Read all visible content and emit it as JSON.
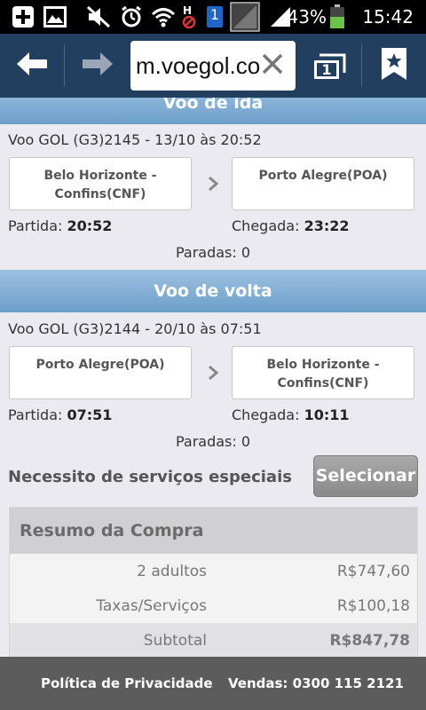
{
  "status_bar": {
    "battery_percent": "43%",
    "clock": "15:42",
    "notification_badge": "1",
    "icons": [
      "add-icon",
      "image-icon",
      "mute-icon",
      "alarm-icon",
      "wifi-icon",
      "no-sim-icon",
      "notification-count-icon",
      "signal-icon",
      "battery-icon"
    ]
  },
  "browser": {
    "url": "m.voegol.com",
    "tab_count": "1",
    "icons": [
      "back-arrow-icon",
      "forward-arrow-icon",
      "clear-icon",
      "tabs-icon",
      "bookmark-star-icon"
    ]
  },
  "outbound": {
    "header": "Voo de ida",
    "flight": "Voo GOL (G3)2145 - 13/10 às 20:52",
    "origin": "Belo Horizonte - Confins(CNF)",
    "destination": "Porto Alegre(POA)",
    "departure_label": "Partida:",
    "departure_time": "20:52",
    "arrival_label": "Chegada:",
    "arrival_time": "23:22",
    "stops": "Paradas: 0"
  },
  "return": {
    "header": "Voo de volta",
    "flight": "Voo GOL (G3)2144 - 20/10 às 07:51",
    "origin": "Porto Alegre(POA)",
    "destination": "Belo Horizonte - Confins(CNF)",
    "departure_label": "Partida:",
    "departure_time": "07:51",
    "arrival_label": "Chegada:",
    "arrival_time": "10:11",
    "stops": "Paradas: 0"
  },
  "special_services": {
    "label": "Necessito de serviços especiais",
    "button": "Selecionar"
  },
  "summary": {
    "title": "Resumo da Compra",
    "rows": [
      {
        "label": "2 adultos",
        "value": "R$747,60"
      },
      {
        "label": "Taxas/Serviços",
        "value": "R$100,18"
      },
      {
        "label": "Subtotal",
        "value": "R$847,78"
      }
    ]
  },
  "footer": {
    "privacy": "Política de Privacidade",
    "sales": "Vendas: 0300 115 2121"
  },
  "colors": {
    "toolbar": "#233f5f",
    "section_header": "#7ea9d3",
    "footer": "#5c5c5c",
    "button": "#999999"
  }
}
